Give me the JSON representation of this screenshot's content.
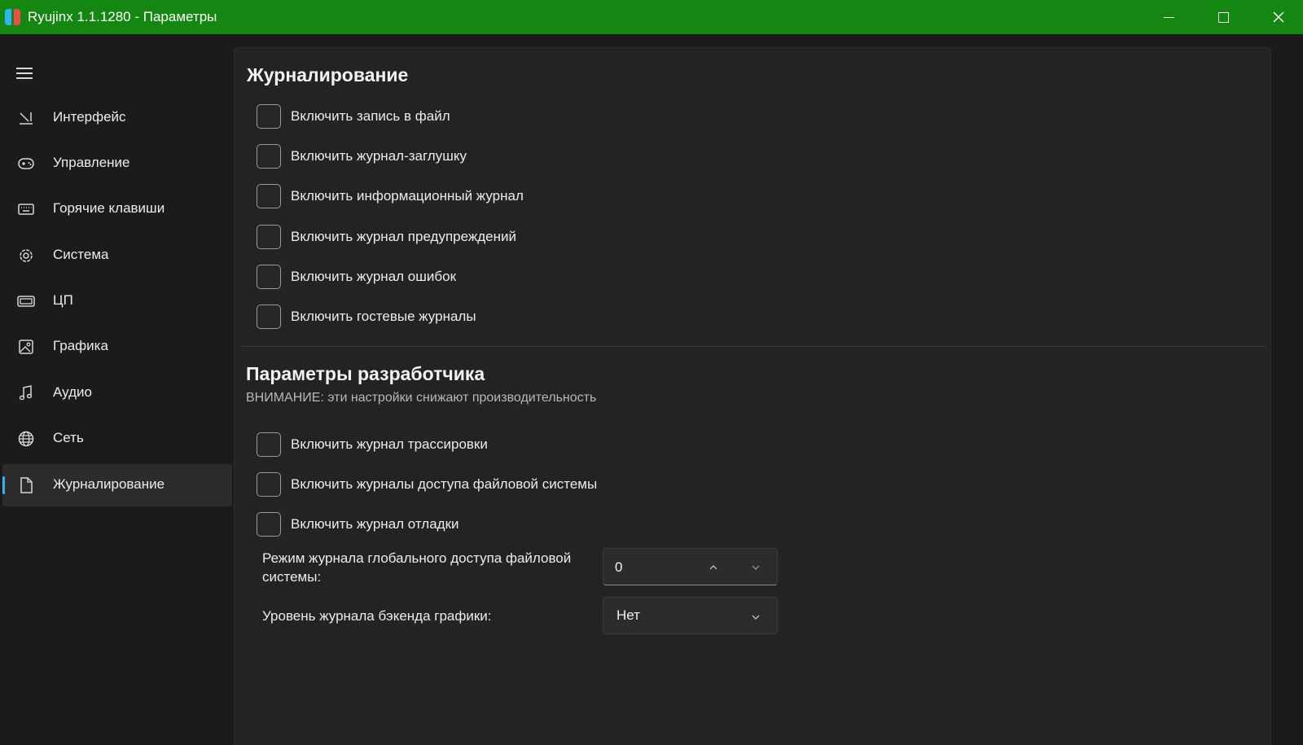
{
  "window": {
    "title": "Ryujinx 1.1.1280 - Параметры",
    "titlebar_color": "#138712"
  },
  "sidebar": {
    "items": [
      {
        "label": "Интерфейс",
        "icon": "interface-icon",
        "active": false
      },
      {
        "label": "Управление",
        "icon": "gamepad-icon",
        "active": false
      },
      {
        "label": "Горячие клавиши",
        "icon": "keyboard-icon",
        "active": false
      },
      {
        "label": "Система",
        "icon": "gear-icon",
        "active": false
      },
      {
        "label": "ЦП",
        "icon": "cpu-icon",
        "active": false
      },
      {
        "label": "Графика",
        "icon": "image-icon",
        "active": false
      },
      {
        "label": "Аудио",
        "icon": "music-note-icon",
        "active": false
      },
      {
        "label": "Сеть",
        "icon": "globe-icon",
        "active": false
      },
      {
        "label": "Журналирование",
        "icon": "document-icon",
        "active": true
      }
    ],
    "accent_color": "#2fb6f0"
  },
  "logging": {
    "title": "Журналирование",
    "options": [
      {
        "label": "Включить запись в файл",
        "checked": false
      },
      {
        "label": "Включить журнал-заглушку",
        "checked": false
      },
      {
        "label": "Включить информационный журнал",
        "checked": false
      },
      {
        "label": "Включить журнал предупреждений",
        "checked": false
      },
      {
        "label": "Включить журнал ошибок",
        "checked": false
      },
      {
        "label": "Включить гостевые журналы",
        "checked": false
      }
    ]
  },
  "developer": {
    "title": "Параметры разработчика",
    "warning": "ВНИМАНИЕ: эти настройки снижают производительность",
    "options": [
      {
        "label": "Включить журнал трассировки",
        "checked": false
      },
      {
        "label": "Включить журналы доступа файловой системы",
        "checked": false
      },
      {
        "label": "Включить журнал отладки",
        "checked": false
      }
    ],
    "fs_access_mode": {
      "label": "Режим журнала глобального доступа файловой системы:",
      "value": "0"
    },
    "graphics_backend_level": {
      "label": "Уровень журнала бэкенда графики:",
      "value": "Нет"
    }
  }
}
